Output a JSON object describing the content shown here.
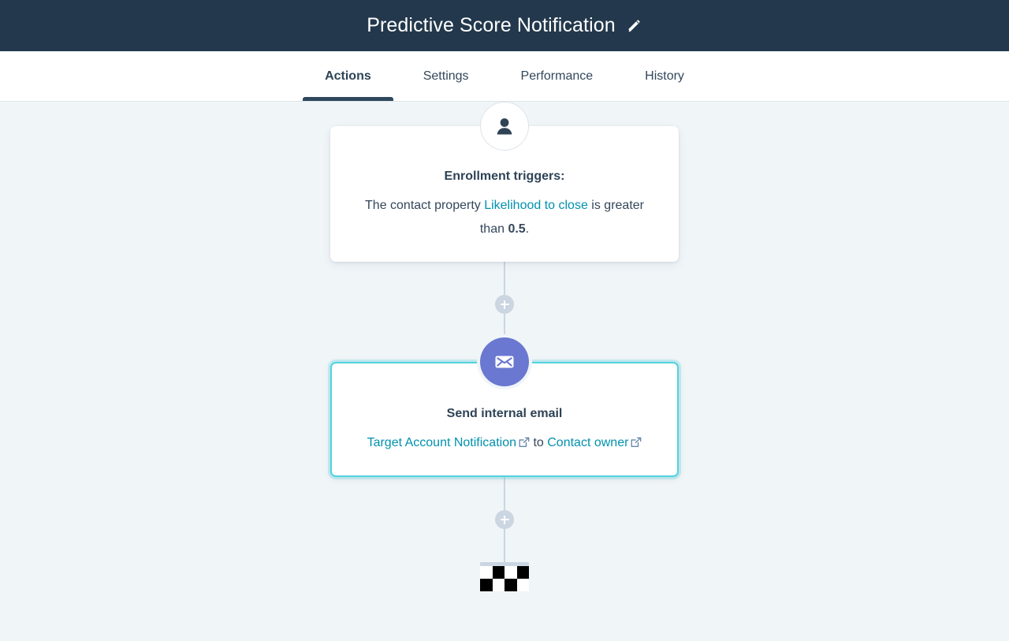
{
  "header": {
    "title": "Predictive Score Notification",
    "edit_icon": "pencil-icon",
    "background_color": "#23384c"
  },
  "tabs": [
    {
      "label": "Actions",
      "active": true
    },
    {
      "label": "Settings",
      "active": false
    },
    {
      "label": "Performance",
      "active": false
    },
    {
      "label": "History",
      "active": false
    }
  ],
  "colors": {
    "canvas_bg": "#f0f5f8",
    "link": "#0091ae",
    "text": "#33475b",
    "selected_border": "#51d3dd",
    "email_badge": "#6a78d1",
    "connector": "#cbd6e2"
  },
  "flow": {
    "enrollment": {
      "icon": "contact-person-icon",
      "title": "Enrollment triggers:",
      "text_prefix": "The contact property ",
      "property_link": "Likelihood to close",
      "text_middle": " is greater than ",
      "threshold": "0.5",
      "text_suffix": "."
    },
    "add_step_1": {
      "label": "+"
    },
    "email_action": {
      "icon": "envelope-icon",
      "title": "Send internal email",
      "email_link": "Target Account Notification",
      "email_link_icon": "external-link-icon",
      "connector_word": "to",
      "recipient_link": "Contact owner",
      "recipient_link_icon": "external-link-icon",
      "selected": true
    },
    "add_step_2": {
      "label": "+"
    },
    "end_marker": {
      "icon": "checkered-flag-icon"
    }
  }
}
